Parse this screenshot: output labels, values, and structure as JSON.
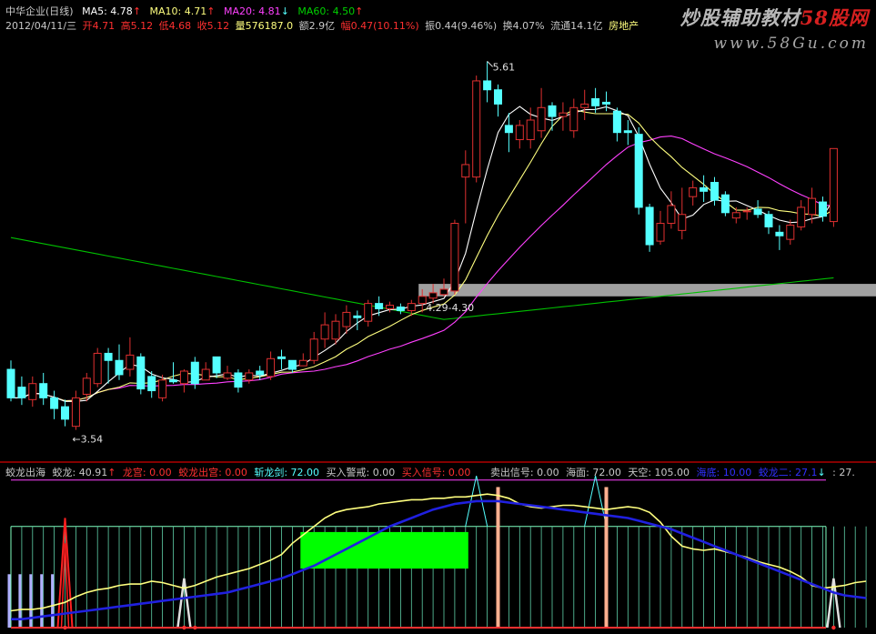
{
  "header": {
    "stock_name": "中华企业(日线)",
    "ma5": "MA5: 4.78",
    "ma10": "MA10: 4.71",
    "ma20": "MA20: 4.81",
    "ma60": "MA60: 4.50",
    "arrow_up": "↑",
    "arrow_down": "↓",
    "date": "2012/04/11/三",
    "open": "开4.71",
    "high": "高5.12",
    "low": "低4.68",
    "close": "收5.12",
    "volume": "量576187.0",
    "amount": "额2.9亿",
    "change": "幅0.47(10.11%)",
    "amplitude": "振0.44(9.46%)",
    "turnover": "换4.07%",
    "float": "流通14.1亿",
    "sector": "房地产"
  },
  "watermark": {
    "title_a": "炒股辅助教材",
    "title_b": "58股网",
    "url": "www.58Gu.com"
  },
  "indicator_header": {
    "main": "蛟龙出海",
    "jiaolong": "蛟龙: 40.91",
    "jiaolong_arrow": "↑",
    "longgong": "龙宫: 0.00",
    "jiaolong_chuhai": "蛟龙出宫: 0.00",
    "zhanlongjian": "斩龙剑: 72.00",
    "mairu_jingjie": "买入警戒: 0.00",
    "mairu_xinhao": "买入信号: 0.00",
    "maichu_xinhao": "卖出信号: 0.00",
    "haimian": "海面: 72.00",
    "tiankong": "天空: 105.00",
    "haidi": "海底: 10.00",
    "jiaolong2": "蛟龙二: 27.1",
    "jiaolong2_arrow": "↓",
    "tail": ": 27."
  },
  "chart_data": {
    "type": "candlestick",
    "colors": {
      "up": "#e03030",
      "down": "#54ffff",
      "ma5": "#ffffff",
      "ma10": "#ffff7f",
      "ma20": "#ff40ff",
      "ma60": "#00c000",
      "band": "#a0a0a0"
    },
    "ylim": [
      3.4,
      5.75
    ],
    "annotations": [
      {
        "text": "5.61",
        "y": 5.61
      },
      {
        "text": "←3.54",
        "y": 3.54
      },
      {
        "text": "4.29-4.30",
        "y": 4.3
      }
    ],
    "resistance_band": {
      "low": 4.29,
      "high": 4.36
    },
    "candles": [
      [
        3.88,
        3.72,
        3.7,
        3.93
      ],
      [
        3.78,
        3.72,
        3.68,
        3.84
      ],
      [
        3.71,
        3.8,
        3.67,
        3.84
      ],
      [
        3.8,
        3.72,
        3.68,
        3.86
      ],
      [
        3.72,
        3.66,
        3.6,
        3.76
      ],
      [
        3.67,
        3.6,
        3.56,
        3.71
      ],
      [
        3.56,
        3.72,
        3.54,
        3.76
      ],
      [
        3.74,
        3.83,
        3.7,
        3.86
      ],
      [
        3.8,
        3.97,
        3.78,
        4.0
      ],
      [
        3.97,
        3.93,
        3.8,
        4.0
      ],
      [
        3.93,
        3.85,
        3.82,
        4.02
      ],
      [
        3.88,
        3.96,
        3.84,
        4.06
      ],
      [
        3.95,
        3.77,
        3.74,
        3.97
      ],
      [
        3.84,
        3.76,
        3.72,
        3.87
      ],
      [
        3.72,
        3.82,
        3.7,
        3.85
      ],
      [
        3.82,
        3.81,
        3.8,
        3.92
      ],
      [
        3.8,
        3.87,
        3.75,
        3.88
      ],
      [
        3.92,
        3.8,
        3.77,
        3.95
      ],
      [
        3.82,
        3.88,
        3.82,
        3.92
      ],
      [
        3.95,
        3.86,
        3.83,
        3.95
      ],
      [
        3.83,
        3.86,
        3.82,
        3.9
      ],
      [
        3.86,
        3.78,
        3.75,
        3.88
      ],
      [
        3.82,
        3.86,
        3.8,
        3.88
      ],
      [
        3.87,
        3.85,
        3.82,
        3.9
      ],
      [
        3.84,
        3.94,
        3.82,
        3.98
      ],
      [
        3.95,
        3.94,
        3.88,
        3.99
      ],
      [
        3.93,
        3.88,
        3.86,
        3.93
      ],
      [
        3.9,
        3.93,
        3.9,
        3.97
      ],
      [
        3.93,
        4.05,
        3.91,
        4.09
      ],
      [
        4.05,
        4.13,
        4.0,
        4.2
      ],
      [
        4.05,
        4.15,
        4.02,
        4.19
      ],
      [
        4.12,
        4.2,
        4.08,
        4.24
      ],
      [
        4.18,
        4.17,
        4.1,
        4.21
      ],
      [
        4.15,
        4.25,
        4.12,
        4.27
      ],
      [
        4.25,
        4.22,
        4.18,
        4.29
      ],
      [
        4.22,
        4.24,
        4.2,
        4.26
      ],
      [
        4.23,
        4.21,
        4.19,
        4.25
      ],
      [
        4.21,
        4.25,
        4.18,
        4.27
      ],
      [
        4.25,
        4.29,
        4.2,
        4.33
      ],
      [
        4.28,
        4.31,
        4.25,
        4.36
      ],
      [
        4.3,
        4.33,
        4.29,
        4.39
      ],
      [
        4.32,
        4.7,
        4.3,
        4.72
      ],
      [
        4.96,
        5.03,
        4.7,
        5.11
      ],
      [
        4.96,
        5.5,
        4.93,
        5.53
      ],
      [
        5.5,
        5.45,
        5.38,
        5.61
      ],
      [
        5.45,
        5.37,
        5.3,
        5.48
      ],
      [
        5.25,
        5.21,
        5.1,
        5.32
      ],
      [
        5.17,
        5.25,
        5.12,
        5.28
      ],
      [
        5.17,
        5.28,
        5.12,
        5.35
      ],
      [
        5.22,
        5.35,
        5.18,
        5.46
      ],
      [
        5.36,
        5.3,
        5.22,
        5.38
      ],
      [
        5.3,
        5.32,
        5.22,
        5.38
      ],
      [
        5.22,
        5.35,
        5.18,
        5.4
      ],
      [
        5.35,
        5.37,
        5.28,
        5.45
      ],
      [
        5.4,
        5.36,
        5.32,
        5.46
      ],
      [
        5.38,
        5.37,
        5.33,
        5.44
      ],
      [
        5.33,
        5.21,
        5.16,
        5.35
      ],
      [
        5.22,
        5.21,
        5.14,
        5.28
      ],
      [
        5.2,
        4.79,
        4.75,
        5.24
      ],
      [
        4.79,
        4.58,
        4.54,
        4.81
      ],
      [
        4.6,
        4.7,
        4.58,
        4.77
      ],
      [
        4.7,
        4.8,
        4.67,
        4.88
      ],
      [
        4.66,
        4.75,
        4.61,
        4.9
      ],
      [
        4.85,
        4.9,
        4.8,
        4.94
      ],
      [
        4.9,
        4.88,
        4.82,
        4.97
      ],
      [
        4.93,
        4.83,
        4.8,
        4.96
      ],
      [
        4.86,
        4.76,
        4.74,
        4.88
      ],
      [
        4.73,
        4.76,
        4.7,
        4.79
      ],
      [
        4.77,
        4.77,
        4.72,
        4.79
      ],
      [
        4.78,
        4.75,
        4.73,
        4.83
      ],
      [
        4.75,
        4.68,
        4.64,
        4.77
      ],
      [
        4.65,
        4.63,
        4.55,
        4.69
      ],
      [
        4.61,
        4.69,
        4.58,
        4.72
      ],
      [
        4.68,
        4.79,
        4.66,
        4.83
      ],
      [
        4.75,
        4.84,
        4.7,
        4.9
      ],
      [
        4.82,
        4.74,
        4.71,
        4.85
      ],
      [
        4.71,
        5.12,
        4.68,
        5.12
      ]
    ],
    "indicator": {
      "ylim": [
        0,
        110
      ],
      "levels": {
        "tiankong": 105,
        "haimian": 72,
        "haidi": 10
      },
      "zone_box": {
        "from": 27,
        "to": 42,
        "low": 42,
        "high": 68
      },
      "yellow": [
        12,
        13,
        13,
        14,
        16,
        18,
        22,
        25,
        27,
        28,
        30,
        31,
        31,
        33,
        32,
        30,
        28,
        30,
        33,
        36,
        38,
        40,
        42,
        45,
        48,
        52,
        60,
        66,
        72,
        78,
        82,
        84,
        85,
        86,
        88,
        89,
        90,
        91,
        91,
        92,
        92,
        93,
        93,
        94,
        95,
        94,
        92,
        88,
        86,
        85,
        86,
        87,
        87,
        86,
        85,
        84,
        85,
        86,
        85,
        82,
        75,
        65,
        58,
        56,
        55,
        56,
        54,
        52,
        50,
        47,
        45,
        43,
        40,
        36,
        30,
        28,
        29,
        30,
        32,
        33
      ],
      "blue": [
        6,
        6,
        7,
        8,
        9,
        10,
        11,
        12,
        13,
        14,
        15,
        16,
        17,
        18,
        19,
        20,
        21,
        22,
        23,
        24,
        25,
        27,
        29,
        31,
        33,
        35,
        38,
        41,
        44,
        48,
        52,
        56,
        60,
        64,
        68,
        72,
        75,
        78,
        81,
        84,
        86,
        88,
        89,
        90,
        90,
        90,
        89,
        88,
        87,
        86,
        85,
        84,
        83,
        82,
        81,
        80,
        79,
        78,
        76,
        74,
        72,
        70,
        67,
        64,
        61,
        58,
        55,
        52,
        49,
        46,
        43,
        40,
        37,
        34,
        31,
        28,
        25,
        23,
        22,
        21
      ],
      "buy_spikes": [
        0,
        1,
        2,
        3,
        4
      ],
      "red_triangle": 5,
      "white_spikes": [
        16,
        76
      ],
      "salmon_bars": [
        45,
        55
      ],
      "cyan_triangles": [
        43,
        54
      ]
    }
  }
}
